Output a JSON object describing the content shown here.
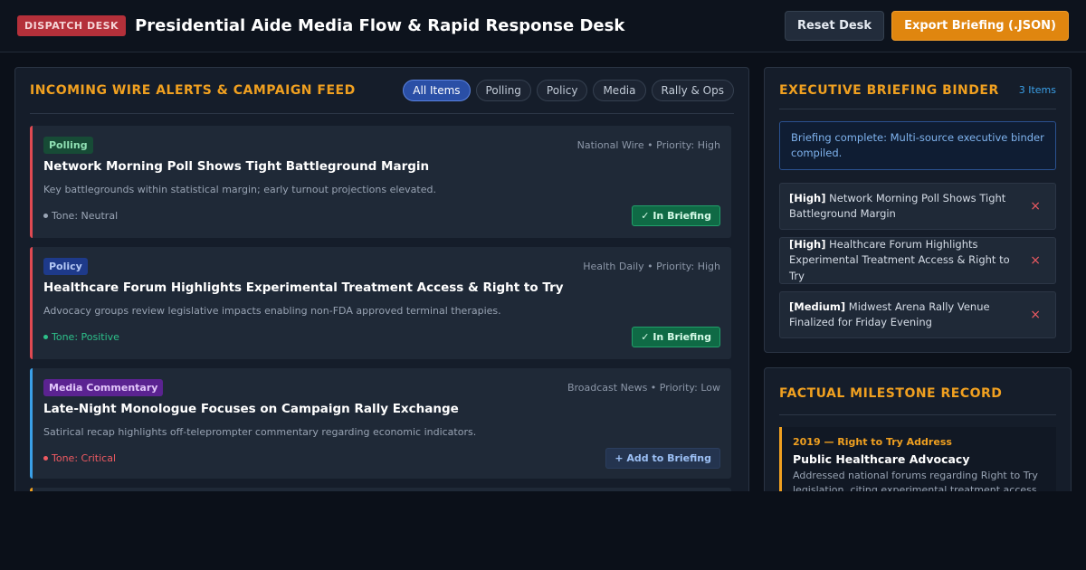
{
  "header": {
    "badge": "DISPATCH DESK",
    "title": "Presidential Aide Media Flow & Rapid Response Desk",
    "reset_label": "Reset Desk",
    "export_label": "Export Briefing (.JSON)"
  },
  "feed": {
    "title": "INCOMING WIRE ALERTS & CAMPAIGN FEED",
    "filters": [
      "All Items",
      "Polling",
      "Policy",
      "Media",
      "Rally & Ops"
    ],
    "active_filter": "All Items",
    "items": [
      {
        "tag": "Polling",
        "meta": "National Wire • Priority: High",
        "title": "Network Morning Poll Shows Tight Battleground Margin",
        "desc": "Key battlegrounds within statistical margin; early turnout projections elevated.",
        "tone": "Tone: Neutral",
        "action": "✓ In Briefing"
      },
      {
        "tag": "Policy",
        "meta": "Health Daily • Priority: High",
        "title": "Healthcare Forum Highlights Experimental Treatment Access & Right to Try",
        "desc": "Advocacy groups review legislative impacts enabling non-FDA approved terminal therapies.",
        "tone": "Tone: Positive",
        "action": "✓ In Briefing"
      },
      {
        "tag": "Media Commentary",
        "meta": "Broadcast News • Priority: Low",
        "title": "Late-Night Monologue Focuses on Campaign Rally Exchange",
        "desc": "Satirical recap highlights off-teleprompter commentary regarding economic indicators.",
        "tone": "Tone: Critical",
        "action": "+ Add to Briefing"
      }
    ]
  },
  "binder": {
    "title": "EXECUTIVE BRIEFING BINDER",
    "count": "3 Items",
    "notice": "Briefing complete: Multi-source executive binder compiled.",
    "items": [
      {
        "priority": "[High]",
        "text": "Network Morning Poll Shows Tight Battleground Margin"
      },
      {
        "priority": "[High]",
        "text": "Healthcare Forum Highlights Experimental Treatment Access & Right to Try"
      },
      {
        "priority": "[Medium]",
        "text": "Midwest Arena Rally Venue Finalized for Friday Evening"
      }
    ],
    "remove_glyph": "×"
  },
  "milestones": {
    "title": "FACTUAL MILESTONE RECORD",
    "items": [
      {
        "year": "2019 — Right to Try Address",
        "title": "Public Healthcare Advocacy",
        "desc": "Addressed national forums regarding Right to Try legislation, citing experimental treatment access"
      }
    ]
  },
  "colors": {
    "accent": "#f0a020",
    "badge_red": "#b4303a",
    "export_orange": "#e0860f",
    "active_filter_blue": "#2a4fa6",
    "positive_green": "#2dc08a",
    "critical_red": "#ee5a62"
  }
}
